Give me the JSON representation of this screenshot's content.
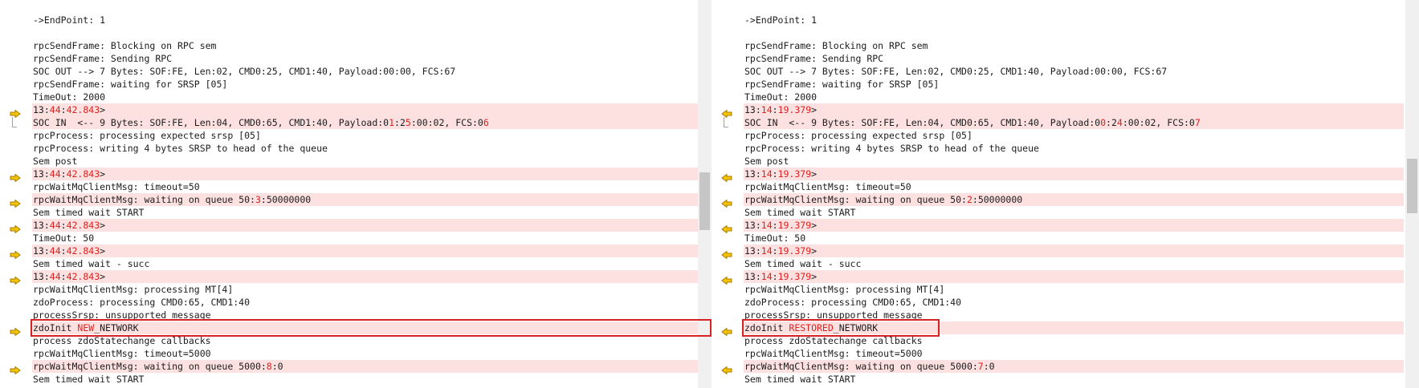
{
  "colors": {
    "diff_bg": "#fde0e0",
    "highlight": "#e0201f",
    "arrow_fill": "#f5c400",
    "arrow_stroke": "#a77b00",
    "annotation": "#d62222"
  },
  "left": {
    "lines": [
      {
        "segs": [
          [
            "->EndPoint: 1",
            0
          ]
        ],
        "diff": false
      },
      {
        "segs": [
          [
            "",
            0
          ]
        ],
        "diff": false
      },
      {
        "segs": [
          [
            "rpcSendFrame: Blocking on RPC sem",
            0
          ]
        ],
        "diff": false
      },
      {
        "segs": [
          [
            "rpcSendFrame: Sending RPC",
            0
          ]
        ],
        "diff": false
      },
      {
        "segs": [
          [
            "SOC OUT --> 7 Bytes: SOF:FE, Len:02, CMD0:25, CMD1:40, Payload:00:00, FCS:67",
            0
          ]
        ],
        "diff": false
      },
      {
        "segs": [
          [
            "rpcSendFrame: waiting for SRSP [05]",
            0
          ]
        ],
        "diff": false
      },
      {
        "segs": [
          [
            "TimeOut: 2000",
            0
          ]
        ],
        "diff": false
      },
      {
        "segs": [
          [
            "13:",
            0
          ],
          [
            "44",
            1
          ],
          [
            ":",
            0
          ],
          [
            "42.843",
            1
          ],
          [
            ">",
            0
          ]
        ],
        "diff": true,
        "marker": "arrow"
      },
      {
        "segs": [
          [
            "SOC IN  <-- 9 Bytes: SOF:FE, Len:04, CMD0:65, CMD1:40, Payload:0",
            0
          ],
          [
            "1",
            1
          ],
          [
            ":2",
            0
          ],
          [
            "5",
            1
          ],
          [
            ":00:02, FCS:0",
            0
          ],
          [
            "6",
            1
          ]
        ],
        "diff": true,
        "marker": "bracket"
      },
      {
        "segs": [
          [
            "rpcProcess: processing expected srsp [05]",
            0
          ]
        ],
        "diff": false
      },
      {
        "segs": [
          [
            "rpcProcess: writing 4 bytes SRSP to head of the queue",
            0
          ]
        ],
        "diff": false
      },
      {
        "segs": [
          [
            "Sem post",
            0
          ]
        ],
        "diff": false
      },
      {
        "segs": [
          [
            "13:",
            0
          ],
          [
            "44",
            1
          ],
          [
            ":",
            0
          ],
          [
            "42.843",
            1
          ],
          [
            ">",
            0
          ]
        ],
        "diff": true,
        "marker": "arrow"
      },
      {
        "segs": [
          [
            "rpcWaitMqClientMsg: timeout=50",
            0
          ]
        ],
        "diff": false
      },
      {
        "segs": [
          [
            "rpcWaitMqClientMsg: waiting on queue 50:",
            0
          ],
          [
            "3",
            1
          ],
          [
            ":50000000",
            0
          ]
        ],
        "diff": true,
        "marker": "arrow"
      },
      {
        "segs": [
          [
            "Sem timed wait START",
            0
          ]
        ],
        "diff": false
      },
      {
        "segs": [
          [
            "13:",
            0
          ],
          [
            "44",
            1
          ],
          [
            ":",
            0
          ],
          [
            "42.843",
            1
          ],
          [
            ">",
            0
          ]
        ],
        "diff": true,
        "marker": "arrow"
      },
      {
        "segs": [
          [
            "TimeOut: 50",
            0
          ]
        ],
        "diff": false
      },
      {
        "segs": [
          [
            "13:",
            0
          ],
          [
            "44",
            1
          ],
          [
            ":",
            0
          ],
          [
            "42.843",
            1
          ],
          [
            ">",
            0
          ]
        ],
        "diff": true,
        "marker": "arrow"
      },
      {
        "segs": [
          [
            "Sem timed wait - succ",
            0
          ]
        ],
        "diff": false
      },
      {
        "segs": [
          [
            "13:",
            0
          ],
          [
            "44",
            1
          ],
          [
            ":",
            0
          ],
          [
            "42.843",
            1
          ],
          [
            ">",
            0
          ]
        ],
        "diff": true,
        "marker": "arrow"
      },
      {
        "segs": [
          [
            "rpcWaitMqClientMsg: processing MT[4]",
            0
          ]
        ],
        "diff": false
      },
      {
        "segs": [
          [
            "zdoProcess: processing CMD0:65, CMD1:40",
            0
          ]
        ],
        "diff": false
      },
      {
        "segs": [
          [
            "processSrsp: unsupported message",
            0
          ]
        ],
        "diff": false
      },
      {
        "segs": [
          [
            "zdoInit ",
            0
          ],
          [
            "NEW",
            1
          ],
          [
            "_NETWORK",
            0
          ]
        ],
        "diff": true,
        "marker": "arrow"
      },
      {
        "segs": [
          [
            "process zdoStatechange callbacks",
            0
          ]
        ],
        "diff": false
      },
      {
        "segs": [
          [
            "rpcWaitMqClientMsg: timeout=5000",
            0
          ]
        ],
        "diff": false
      },
      {
        "segs": [
          [
            "rpcWaitMqClientMsg: waiting on queue 5000:",
            0
          ],
          [
            "8",
            1
          ],
          [
            ":0",
            0
          ]
        ],
        "diff": true,
        "marker": "arrow"
      },
      {
        "segs": [
          [
            "Sem timed wait START",
            0
          ]
        ],
        "diff": false
      }
    ]
  },
  "right": {
    "lines": [
      {
        "segs": [
          [
            "->EndPoint: 1",
            0
          ]
        ],
        "diff": false
      },
      {
        "segs": [
          [
            "",
            0
          ]
        ],
        "diff": false
      },
      {
        "segs": [
          [
            "rpcSendFrame: Blocking on RPC sem",
            0
          ]
        ],
        "diff": false
      },
      {
        "segs": [
          [
            "rpcSendFrame: Sending RPC",
            0
          ]
        ],
        "diff": false
      },
      {
        "segs": [
          [
            "SOC OUT --> 7 Bytes: SOF:FE, Len:02, CMD0:25, CMD1:40, Payload:00:00, FCS:67",
            0
          ]
        ],
        "diff": false
      },
      {
        "segs": [
          [
            "rpcSendFrame: waiting for SRSP [05]",
            0
          ]
        ],
        "diff": false
      },
      {
        "segs": [
          [
            "TimeOut: 2000",
            0
          ]
        ],
        "diff": false
      },
      {
        "segs": [
          [
            "13:",
            0
          ],
          [
            "14",
            1
          ],
          [
            ":",
            0
          ],
          [
            "19.379",
            1
          ],
          [
            ">",
            0
          ]
        ],
        "diff": true,
        "marker": "arrow"
      },
      {
        "segs": [
          [
            "SOC IN  <-- 9 Bytes: SOF:FE, Len:04, CMD0:65, CMD1:40, Payload:0",
            0
          ],
          [
            "0",
            1
          ],
          [
            ":2",
            0
          ],
          [
            "4",
            1
          ],
          [
            ":00:02, FCS:0",
            0
          ],
          [
            "7",
            1
          ]
        ],
        "diff": true,
        "marker": "bracket"
      },
      {
        "segs": [
          [
            "rpcProcess: processing expected srsp [05]",
            0
          ]
        ],
        "diff": false
      },
      {
        "segs": [
          [
            "rpcProcess: writing 4 bytes SRSP to head of the queue",
            0
          ]
        ],
        "diff": false
      },
      {
        "segs": [
          [
            "Sem post",
            0
          ]
        ],
        "diff": false
      },
      {
        "segs": [
          [
            "13:",
            0
          ],
          [
            "14",
            1
          ],
          [
            ":",
            0
          ],
          [
            "19.379",
            1
          ],
          [
            ">",
            0
          ]
        ],
        "diff": true,
        "marker": "arrow"
      },
      {
        "segs": [
          [
            "rpcWaitMqClientMsg: timeout=50",
            0
          ]
        ],
        "diff": false
      },
      {
        "segs": [
          [
            "rpcWaitMqClientMsg: waiting on queue 50:",
            0
          ],
          [
            "2",
            1
          ],
          [
            ":50000000",
            0
          ]
        ],
        "diff": true,
        "marker": "arrow"
      },
      {
        "segs": [
          [
            "Sem timed wait START",
            0
          ]
        ],
        "diff": false
      },
      {
        "segs": [
          [
            "13:",
            0
          ],
          [
            "14",
            1
          ],
          [
            ":",
            0
          ],
          [
            "19.379",
            1
          ],
          [
            ">",
            0
          ]
        ],
        "diff": true,
        "marker": "arrow"
      },
      {
        "segs": [
          [
            "TimeOut: 50",
            0
          ]
        ],
        "diff": false
      },
      {
        "segs": [
          [
            "13:",
            0
          ],
          [
            "14",
            1
          ],
          [
            ":",
            0
          ],
          [
            "19.379",
            1
          ],
          [
            ">",
            0
          ]
        ],
        "diff": true,
        "marker": "arrow"
      },
      {
        "segs": [
          [
            "Sem timed wait - succ",
            0
          ]
        ],
        "diff": false
      },
      {
        "segs": [
          [
            "13:",
            0
          ],
          [
            "14",
            1
          ],
          [
            ":",
            0
          ],
          [
            "19.379",
            1
          ],
          [
            ">",
            0
          ]
        ],
        "diff": true,
        "marker": "arrow"
      },
      {
        "segs": [
          [
            "rpcWaitMqClientMsg: processing MT[4]",
            0
          ]
        ],
        "diff": false
      },
      {
        "segs": [
          [
            "zdoProcess: processing CMD0:65, CMD1:40",
            0
          ]
        ],
        "diff": false
      },
      {
        "segs": [
          [
            "processSrsp: unsupported message",
            0
          ]
        ],
        "diff": false
      },
      {
        "segs": [
          [
            "zdoInit ",
            0
          ],
          [
            "RESTORED",
            1
          ],
          [
            "_NETWORK",
            0
          ]
        ],
        "diff": true,
        "marker": "arrow"
      },
      {
        "segs": [
          [
            "process zdoStatechange callbacks",
            0
          ]
        ],
        "diff": false
      },
      {
        "segs": [
          [
            "rpcWaitMqClientMsg: timeout=5000",
            0
          ]
        ],
        "diff": false
      },
      {
        "segs": [
          [
            "rpcWaitMqClientMsg: waiting on queue 5000:",
            0
          ],
          [
            "7",
            1
          ],
          [
            ":0",
            0
          ]
        ],
        "diff": true,
        "marker": "arrow"
      },
      {
        "segs": [
          [
            "Sem timed wait START",
            0
          ]
        ],
        "diff": false
      }
    ]
  }
}
